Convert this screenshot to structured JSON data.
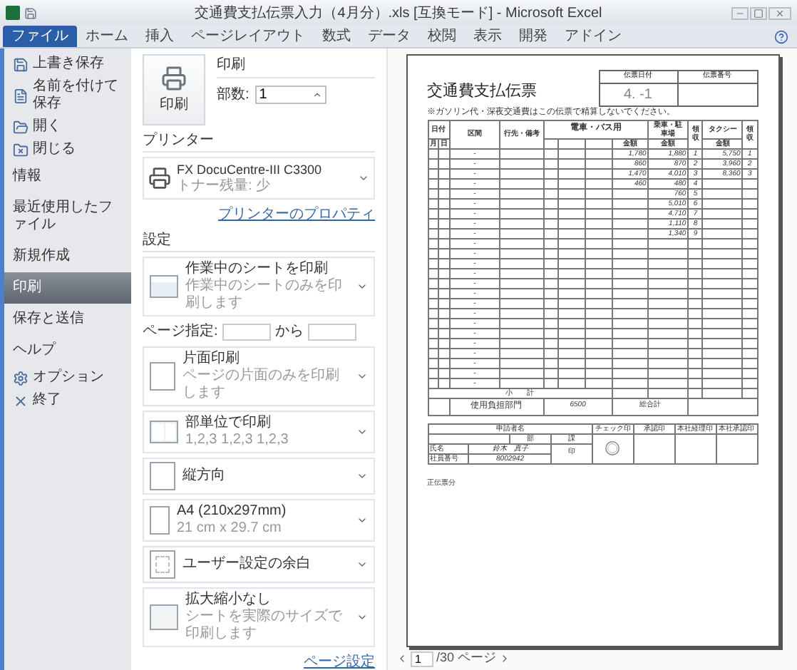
{
  "window": {
    "title": "交通費支払伝票入力（4月分）.xls  [互換モード] - Microsoft Excel"
  },
  "ribbon_tabs": [
    {
      "label": "ファイル",
      "selected": true
    },
    {
      "label": "ホーム",
      "selected": false
    },
    {
      "label": "挿入",
      "selected": false
    },
    {
      "label": "ページレイアウト",
      "selected": false
    },
    {
      "label": "数式",
      "selected": false
    },
    {
      "label": "データ",
      "selected": false
    },
    {
      "label": "校閲",
      "selected": false
    },
    {
      "label": "表示",
      "selected": false
    },
    {
      "label": "開発",
      "selected": false
    },
    {
      "label": "アドイン",
      "selected": false
    }
  ],
  "backstage_menu": [
    {
      "label": "上書き保存",
      "kind": "save",
      "selected": false
    },
    {
      "label": "名前を付けて保存",
      "kind": "saveas",
      "selected": false
    },
    {
      "label": "開く",
      "kind": "open",
      "selected": false
    },
    {
      "label": "閉じる",
      "kind": "close",
      "selected": false
    },
    {
      "label": "情報",
      "kind": "section",
      "selected": false
    },
    {
      "label": "最近使用したファイル",
      "kind": "section",
      "selected": false
    },
    {
      "label": "新規作成",
      "kind": "section",
      "selected": false
    },
    {
      "label": "印刷",
      "kind": "section",
      "selected": true
    },
    {
      "label": "保存と送信",
      "kind": "section",
      "selected": false
    },
    {
      "label": "ヘルプ",
      "kind": "section",
      "selected": false
    },
    {
      "label": "オプション",
      "kind": "options",
      "selected": false
    },
    {
      "label": "終了",
      "kind": "exit",
      "selected": false
    }
  ],
  "print": {
    "button": "印刷",
    "heading": "印刷",
    "copies_label": "部数:",
    "copies": "1"
  },
  "printer": {
    "heading": "プリンター",
    "name": "FX DocuCentre-III C3300",
    "status": "トナー残量: 少",
    "properties_link": "プリンターのプロパティ"
  },
  "settings": {
    "heading": "設定",
    "pages_label": "ページ指定:",
    "to_label": "から",
    "page_setup_link": "ページ設定",
    "options": [
      {
        "title": "作業中のシートを印刷",
        "subtitle": "作業中のシートのみを印刷します",
        "kind": "sheet"
      },
      {
        "title": "片面印刷",
        "subtitle": "ページの片面のみを印刷します",
        "kind": "simplex"
      },
      {
        "title": "部単位で印刷",
        "subtitle": "1,2,3    1,2,3    1,2,3",
        "kind": "collate"
      },
      {
        "title": "縦方向",
        "kind": "portrait"
      },
      {
        "title": "A4 (210x297mm)",
        "subtitle": "21 cm x 29.7 cm",
        "kind": "paper"
      },
      {
        "title": "ユーザー設定の余白",
        "kind": "margins"
      },
      {
        "title": "拡大縮小なし",
        "subtitle": "シートを実際のサイズで印刷します",
        "kind": "scale"
      }
    ]
  },
  "document": {
    "title": "交通費支払伝票",
    "date_label": "伝票日付",
    "date": "4. -1",
    "number_label": "伝票番号",
    "note": "※ガソリン代・深夜交通費はこの伝票で精算しないでください。",
    "headers": {
      "date": "日付",
      "month": "月",
      "day": "日",
      "route": "区間",
      "destination": "行先・備考",
      "train": "電車・バス用",
      "train_amount": "金額",
      "ride": "乗車・駐車場",
      "ride_amount": "金額",
      "ride_receipt": "領収",
      "taxi": "タクシー",
      "taxi_amount": "金額",
      "taxi_receipt": "領収"
    },
    "rows": [
      {
        "route": "-",
        "train": "1,780",
        "ride": "1,880",
        "ride_no": "1",
        "taxi": "5,750",
        "taxi_no": "1"
      },
      {
        "route": "-",
        "train": "860",
        "ride": "870",
        "ride_no": "2",
        "taxi": "3,960",
        "taxi_no": "2"
      },
      {
        "route": "-",
        "train": "1,470",
        "ride": "4,010",
        "ride_no": "3",
        "taxi": "8,360",
        "taxi_no": "3"
      },
      {
        "route": "-",
        "train": "460",
        "ride": "480",
        "ride_no": "4"
      },
      {
        "route": "-",
        "ride": "760",
        "ride_no": "5"
      },
      {
        "route": "-",
        "ride": "5,010",
        "ride_no": "6"
      },
      {
        "route": "-",
        "ride": "4,710",
        "ride_no": "7"
      },
      {
        "route": "-",
        "ride": "1,110",
        "ride_no": "8"
      },
      {
        "route": "-",
        "ride": "1,340",
        "ride_no": "9"
      },
      {
        "route": "-"
      },
      {
        "route": "-"
      },
      {
        "route": "-"
      },
      {
        "route": "-"
      },
      {
        "route": "-"
      },
      {
        "route": "-"
      },
      {
        "route": "-"
      },
      {
        "route": "-"
      },
      {
        "route": "-"
      },
      {
        "route": "-"
      },
      {
        "route": "-"
      },
      {
        "route": "-"
      },
      {
        "route": "-"
      },
      {
        "route": "-"
      },
      {
        "route": "-"
      }
    ],
    "subtotal": "小　　計",
    "department_label": "使用負担部門",
    "department": "6500",
    "total_label": "総合計",
    "approval": {
      "applicant": "申請者名",
      "dept": "部",
      "section": "課",
      "name_label": "氏名",
      "name": "鈴木　真子",
      "number_label": "社員番号",
      "number": "8002942",
      "seal": "印",
      "check": "チェック印",
      "approve": "承認印",
      "hq_accounting": "本社経理印",
      "hq_approve": "本社承認印"
    },
    "footer": "正伝票分"
  },
  "page_nav": {
    "page": "1",
    "total": "/30 ページ"
  }
}
